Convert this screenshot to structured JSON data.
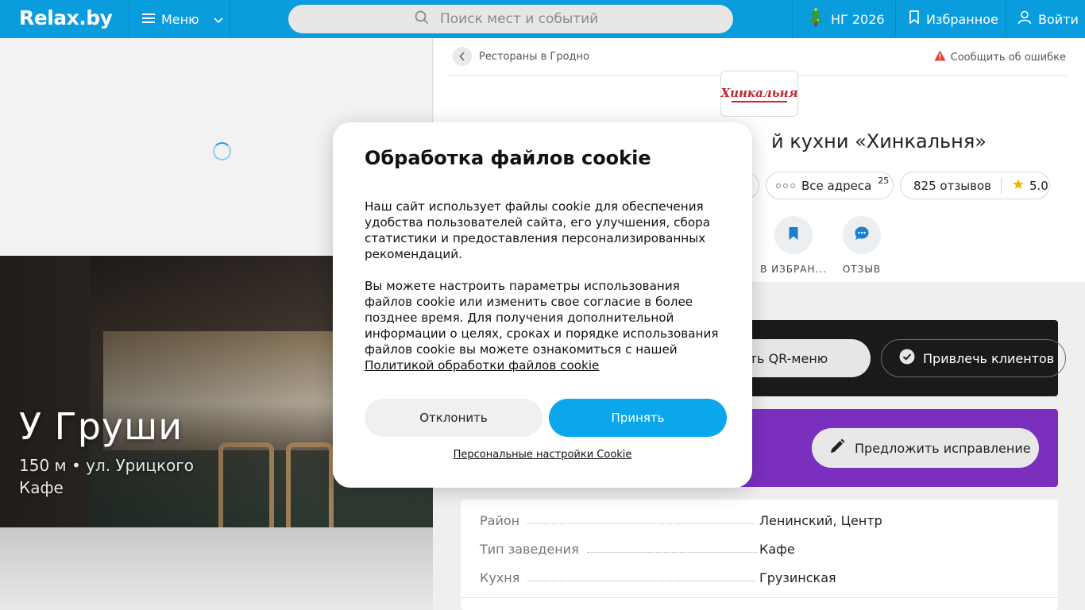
{
  "header": {
    "logo": "Relax.by",
    "menu_label": "Меню",
    "search_placeholder": "Поиск мест и событий",
    "ng_label": "НГ 2026",
    "favorites_label": "Избранное",
    "login_label": "Войти"
  },
  "left": {
    "photo_title": "У Груши",
    "photo_meta": "150 м • ул. Урицкого",
    "photo_type": "Кафе"
  },
  "venue": {
    "breadcrumb": "Рестораны в Гродно",
    "report_label": "Сообщить об ошибке",
    "logo_text": "Хинкальня",
    "title": "й кухни «Хинкальня»",
    "addresses_label": "Все адреса",
    "addresses_count": "25",
    "reviews_label": "825 отзывов",
    "rating": "5.0",
    "action_favorite": "В ИЗБРАН...",
    "action_review": "ОТЗЫВ",
    "qr_button": "ть QR-меню",
    "clients_button": "Привлечь клиентов",
    "suggest_button": "Предложить исправление",
    "info": [
      {
        "key": "Район",
        "value": "Ленинский, Центр"
      },
      {
        "key": "Тип заведения",
        "value": "Кафе"
      },
      {
        "key": "Кухня",
        "value": "Грузинская"
      }
    ]
  },
  "cookie_modal": {
    "title": "Обработка файлов cookie",
    "paragraph1": "Наш сайт использует файлы cookie для обеспечения удобства пользователей сайта, его улучшения, сбора статистики и предоставления персонализированных рекомендаций.",
    "paragraph2": "Вы можете настроить параметры использования файлов cookie или изменить свое согласие в более позднее время. Для получения дополнительной информации о целях, сроках и порядке использования файлов cookie вы можете ознакомиться с нашей",
    "policy_link": "Политикой обработки файлов cookie",
    "decline_button": "Отклонить",
    "accept_button": "Принять",
    "settings_link": "Персональные настройки Cookie"
  },
  "colors": {
    "header_bg": "#0a9dde",
    "accept": "#0aa7ec",
    "purple_card": "#7b2fbe",
    "dark_card": "#1a1a1a",
    "star": "#f2b400"
  },
  "icons": [
    "menu-icon",
    "chevron-down-icon",
    "search-icon",
    "tree-icon",
    "bookmark-icon",
    "user-icon",
    "back-chevron-icon",
    "warning-icon",
    "dots-icon",
    "star-icon",
    "bookmark-icon",
    "chat-icon",
    "check-icon",
    "pencil-icon"
  ]
}
